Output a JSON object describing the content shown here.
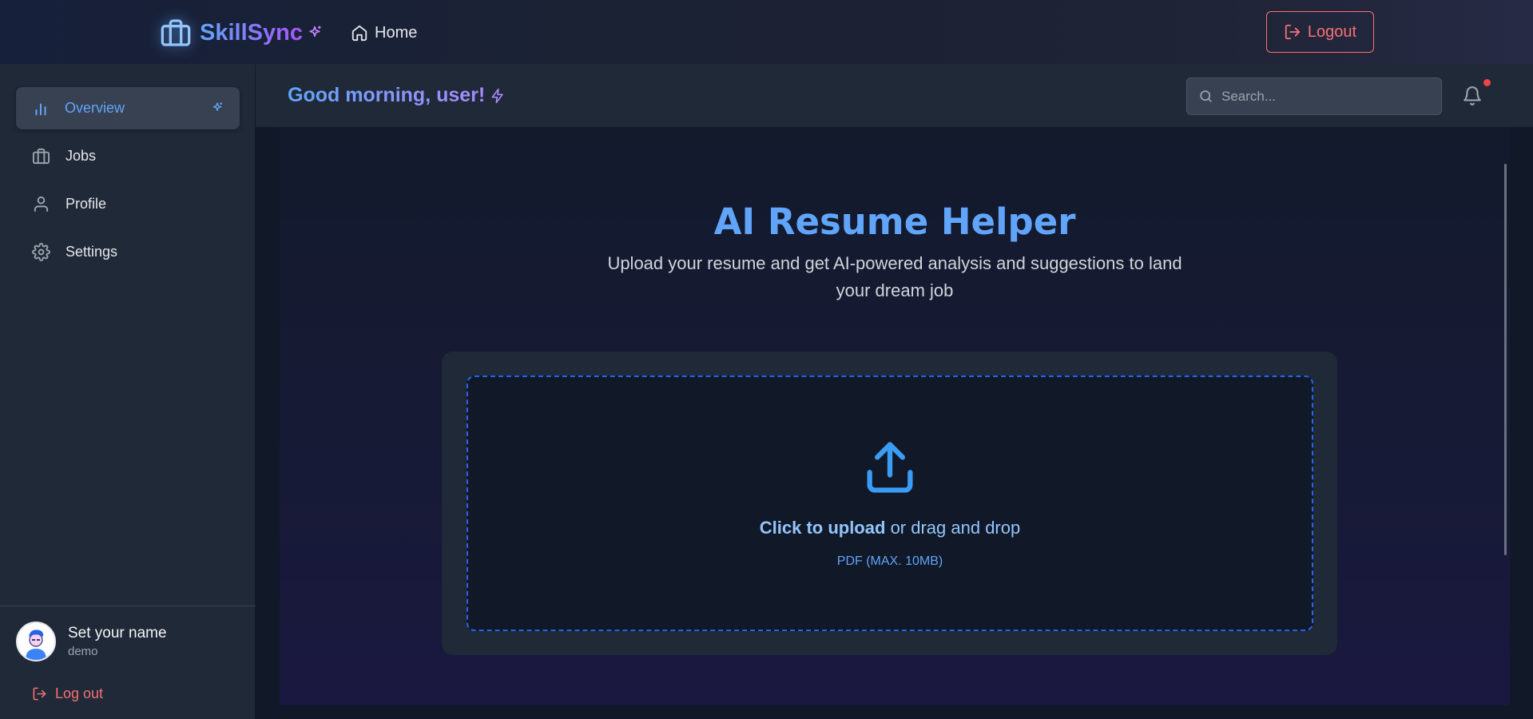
{
  "app": {
    "brand_name": "SkillSync",
    "brand_icon": "briefcase-icon",
    "accent_color": "#60a5fa",
    "brand_gradient": [
      "#60a5fa",
      "#a855f7"
    ],
    "danger_color": "#f87171"
  },
  "topbar": {
    "home_label": "Home",
    "logout_label": "Logout"
  },
  "sidebar": {
    "items": [
      {
        "label": "Overview",
        "icon": "bar-chart-icon",
        "active": true
      },
      {
        "label": "Jobs",
        "icon": "briefcase-icon",
        "active": false
      },
      {
        "label": "Profile",
        "icon": "user-icon",
        "active": false
      },
      {
        "label": "Settings",
        "icon": "gear-icon",
        "active": false
      }
    ],
    "user": {
      "name": "Set your name",
      "subtitle": "demo"
    },
    "logout_label": "Log out"
  },
  "header": {
    "greeting": "Good morning, user!",
    "search_placeholder": "Search...",
    "notification_dot": true
  },
  "main": {
    "title": "AI Resume Helper",
    "subtitle": "Upload your resume and get AI-powered analysis and suggestions to land your dream job",
    "upload": {
      "cta": "Click to upload",
      "rest": "or drag and drop",
      "hint": "PDF (MAX. 10MB)",
      "icon": "upload-icon"
    }
  }
}
